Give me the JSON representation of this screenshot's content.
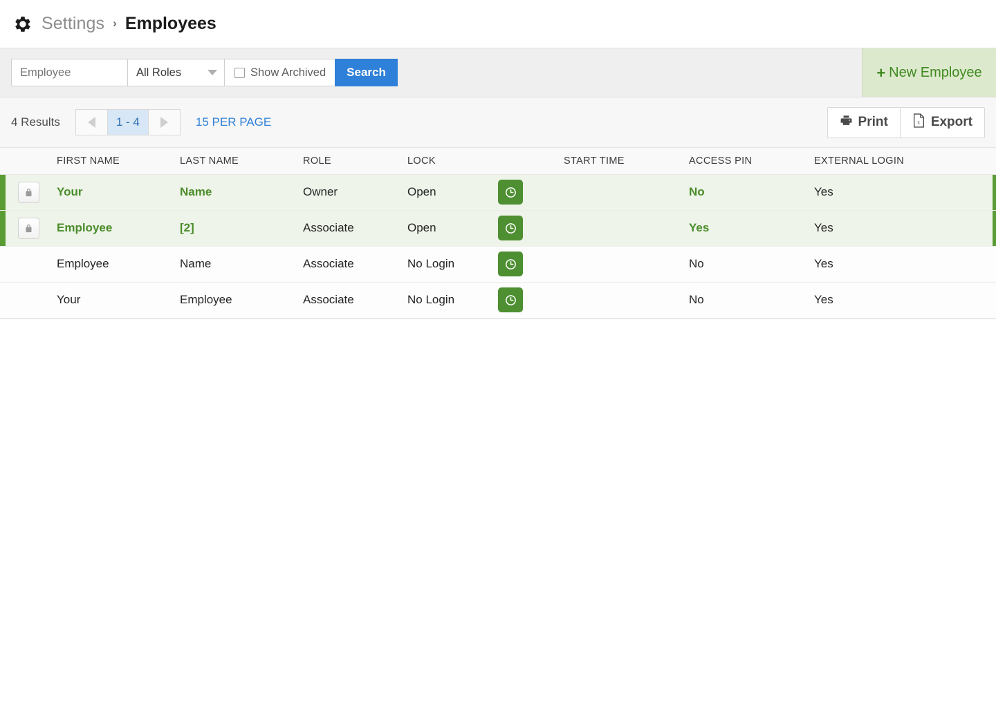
{
  "breadcrumb": {
    "icon": "gear-icon",
    "parent": "Settings",
    "separator": "›",
    "current": "Employees"
  },
  "search": {
    "input_value": "",
    "input_placeholder": "Employee",
    "role_selected": "All Roles",
    "role_options": [
      "All Roles"
    ],
    "show_archived_label": "Show Archived",
    "show_archived_checked": false,
    "search_button": "Search",
    "search_button_color": "#2f80d8"
  },
  "new_employee": {
    "plus": "+",
    "label": "New Employee",
    "bg_color": "#dde9cd",
    "text_color": "#3f8a20"
  },
  "results": {
    "count_label": "4 Results",
    "prev_icon": "chevron-left-icon",
    "page_range": "1 - 4",
    "next_icon": "chevron-right-icon",
    "per_page": "15 PER PAGE",
    "per_page_color": "#2f80d8"
  },
  "toolbar": {
    "print_label": "Print",
    "print_icon": "printer-icon",
    "export_label": "Export",
    "export_icon": "excel-document-icon"
  },
  "table": {
    "columns": [
      "FIRST NAME",
      "LAST NAME",
      "ROLE",
      "LOCK",
      "START TIME",
      "ACCESS PIN",
      "EXTERNAL LOGIN"
    ],
    "highlight_color": "#5a9c34",
    "highlight_row_bg": "#eef4e9",
    "rows": [
      {
        "highlighted": true,
        "locked_icon": "lock-icon",
        "first_name": "Your",
        "last_name": "Name",
        "role": "Owner",
        "lock": "Open",
        "clock_icon": "clock-icon",
        "start_time": "",
        "access_pin": "No",
        "external_login": "Yes"
      },
      {
        "highlighted": true,
        "locked_icon": "lock-icon",
        "first_name": "Employee",
        "last_name": "[2]",
        "role": "Associate",
        "lock": "Open",
        "clock_icon": "clock-icon",
        "start_time": "",
        "access_pin": "Yes",
        "external_login": "Yes"
      },
      {
        "highlighted": false,
        "locked_icon": "",
        "first_name": "Employee",
        "last_name": "Name",
        "role": "Associate",
        "lock": "No Login",
        "clock_icon": "clock-icon",
        "start_time": "",
        "access_pin": "No",
        "external_login": "Yes"
      },
      {
        "highlighted": false,
        "locked_icon": "",
        "first_name": "Your",
        "last_name": "Employee",
        "role": "Associate",
        "lock": "No Login",
        "clock_icon": "clock-icon",
        "start_time": "",
        "access_pin": "No",
        "external_login": "Yes"
      }
    ]
  }
}
